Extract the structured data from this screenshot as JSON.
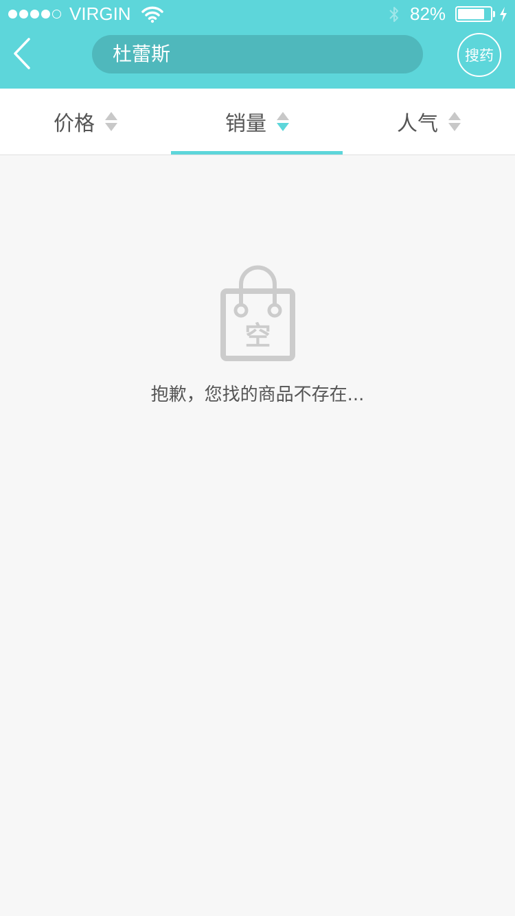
{
  "status_bar": {
    "carrier": "VIRGIN",
    "battery_percent": "82%",
    "battery_level": 0.82,
    "signal_bars_filled": 4,
    "signal_bars_total": 5
  },
  "header": {
    "search_value": "杜蕾斯",
    "search_button_label": "搜药",
    "background_color": "#5dd6da",
    "search_box_color": "#4fb8bc"
  },
  "sort_tabs": [
    {
      "label": "价格",
      "active": false
    },
    {
      "label": "销量",
      "active": true
    },
    {
      "label": "人气",
      "active": false
    }
  ],
  "empty_state": {
    "icon_label": "空",
    "message": "抱歉，您找的商品不存在..."
  },
  "colors": {
    "accent": "#5dd6da",
    "icon_gray": "#cccccc",
    "text_gray": "#555555",
    "page_bg": "#f7f7f7"
  }
}
